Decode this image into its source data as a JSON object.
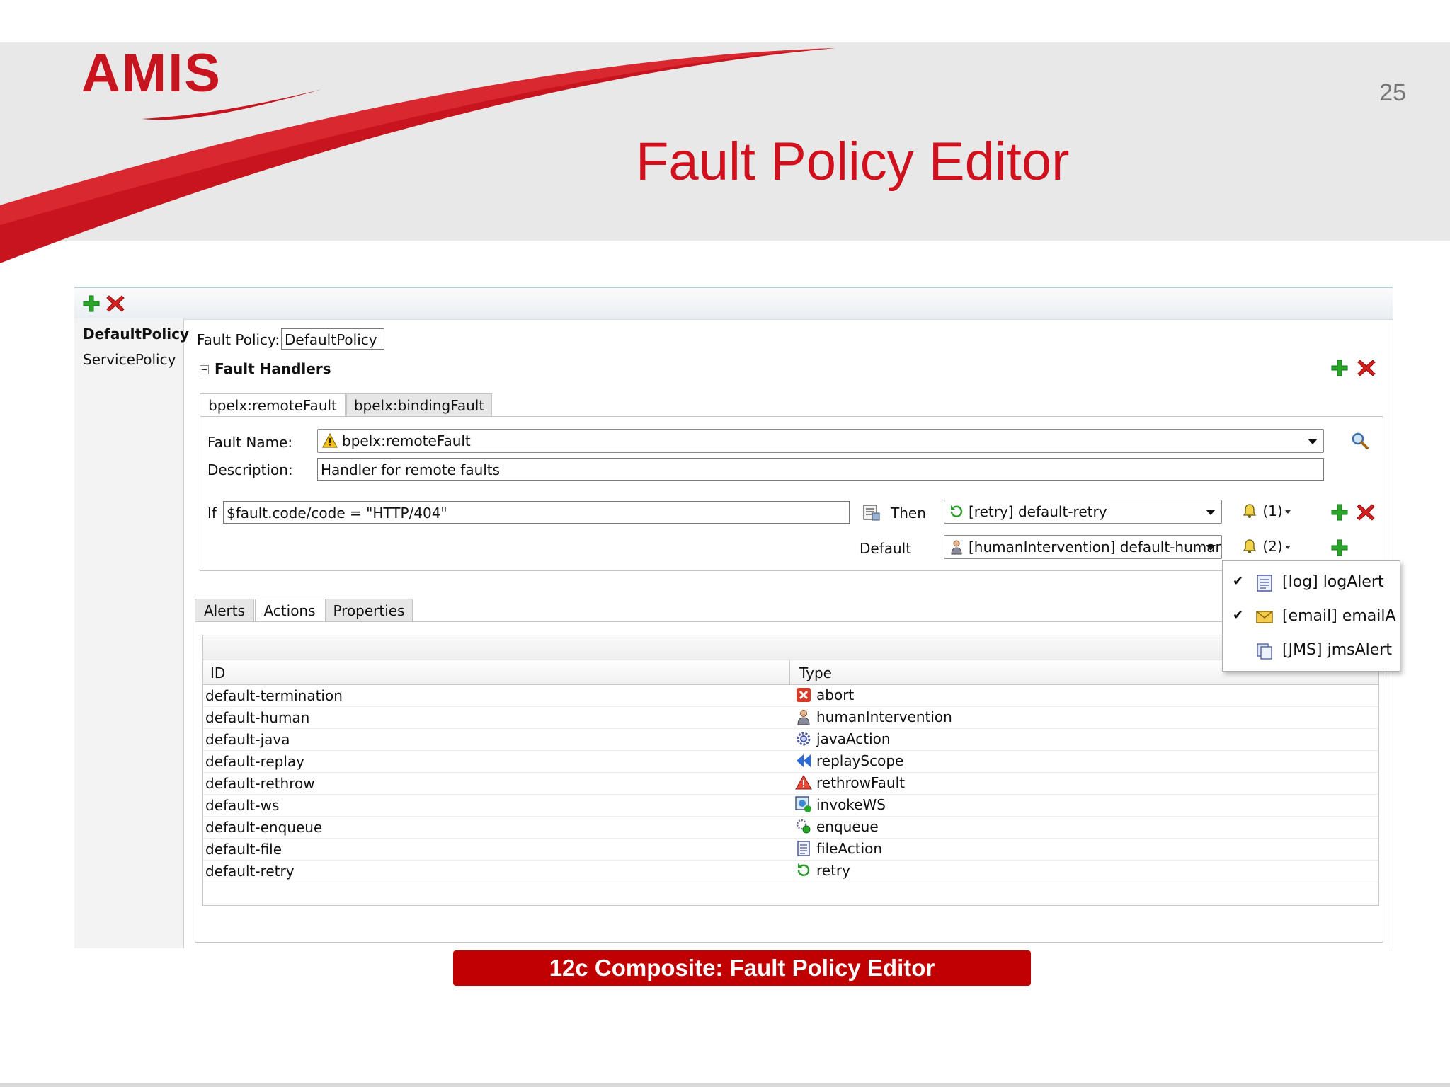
{
  "slide": {
    "logo": "AMIS",
    "number": "25",
    "title": "Fault Policy Editor",
    "caption": "12c Composite: Fault Policy Editor",
    "colors": {
      "brand_red": "#c8141e",
      "caption_bg": "#c00000",
      "add_green": "#2aa52a",
      "delete_red": "#d42020"
    }
  },
  "toolbar": {
    "add_icon": "add-icon",
    "delete_icon": "delete-icon"
  },
  "sidebar": {
    "items": [
      {
        "label": "DefaultPolicy",
        "selected": true
      },
      {
        "label": "ServicePolicy",
        "selected": false
      }
    ]
  },
  "policy": {
    "label": "Fault Policy:",
    "value": "DefaultPolicy",
    "section_title": "Fault Handlers"
  },
  "handler_tabs": [
    {
      "label": "bpelx:remoteFault",
      "active": true
    },
    {
      "label": "bpelx:bindingFault",
      "active": false
    }
  ],
  "handler": {
    "fault_name_label": "Fault Name:",
    "fault_name_value": "bpelx:remoteFault",
    "description_label": "Description:",
    "description_value": "Handler for remote faults",
    "if_label": "If",
    "condition_value": "$fault.code/code = \"HTTP/404\"",
    "then_label": "Then",
    "then_action": "[retry] default-retry",
    "then_alerts": "(1)",
    "default_label": "Default",
    "default_action": "[humanIntervention] default-human",
    "default_alerts": "(2)"
  },
  "bottom_tabs": [
    {
      "label": "Alerts",
      "active": false
    },
    {
      "label": "Actions",
      "active": true
    },
    {
      "label": "Properties",
      "active": false
    }
  ],
  "actions_table": {
    "columns": [
      "ID",
      "Type"
    ],
    "rows": [
      {
        "id": "default-termination",
        "type": "abort",
        "icon": "abort-icon"
      },
      {
        "id": "default-human",
        "type": "humanIntervention",
        "icon": "human-icon"
      },
      {
        "id": "default-java",
        "type": "javaAction",
        "icon": "gear-icon"
      },
      {
        "id": "default-replay",
        "type": "replayScope",
        "icon": "replay-icon"
      },
      {
        "id": "default-rethrow",
        "type": "rethrowFault",
        "icon": "rethrow-icon"
      },
      {
        "id": "default-ws",
        "type": "invokeWS",
        "icon": "webservice-icon"
      },
      {
        "id": "default-enqueue",
        "type": "enqueue",
        "icon": "enqueue-icon"
      },
      {
        "id": "default-file",
        "type": "fileAction",
        "icon": "file-icon"
      },
      {
        "id": "default-retry",
        "type": "retry",
        "icon": "retry-icon"
      }
    ]
  },
  "alerts_menu": {
    "items": [
      {
        "label": "[log] logAlert",
        "checked": true,
        "icon": "log-icon"
      },
      {
        "label": "[email] emailA",
        "checked": true,
        "icon": "email-icon"
      },
      {
        "label": "[JMS] jmsAlert",
        "checked": false,
        "icon": "jms-icon"
      }
    ]
  }
}
